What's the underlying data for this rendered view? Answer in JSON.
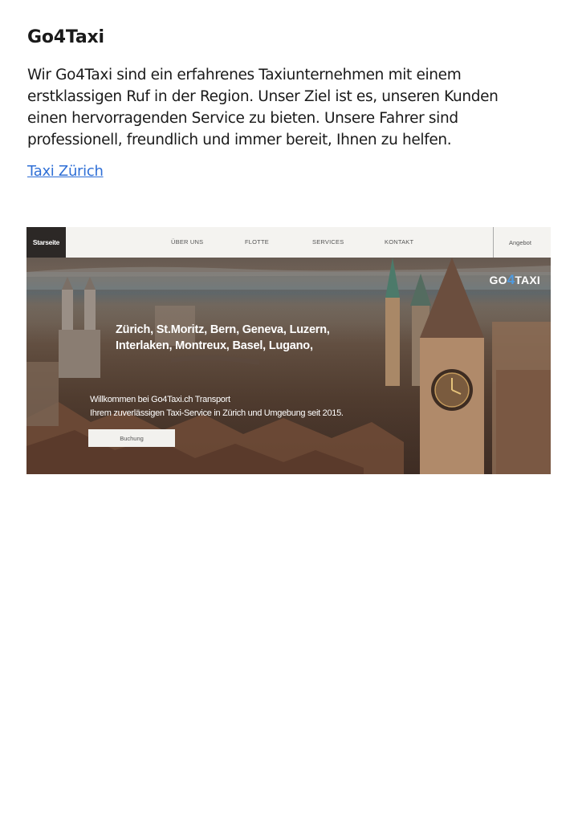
{
  "heading": "Go4Taxi",
  "description": "Wir Go4Taxi sind ein erfahrenes Taxiunternehmen mit einem erstklassigen Ruf in der Region. Unser Ziel ist es, unseren Kunden einen hervorragenden Service zu bieten. Unsere Fahrer sind professionell, freundlich und immer bereit, Ihnen zu helfen.",
  "link_text": "Taxi Zürich",
  "website": {
    "nav": {
      "home": "Starseite",
      "items": [
        "ÜBER UNS",
        "FLOTTE",
        "SERVICES",
        "KONTAKT"
      ],
      "offer": "Angebot"
    },
    "logo_prefix": "GO",
    "logo_digit": "4",
    "logo_suffix": "TAXI",
    "cities_line1": "Zürich, St.Moritz, Bern, Geneva, Luzern,",
    "cities_line2": "Interlaken, Montreux, Basel, Lugano,",
    "welcome_line1": "Willkommen bei Go4Taxi.ch Transport",
    "welcome_line2": "Ihrem zuverlässigen Taxi-Service in Zürich und Umgebung seit 2015.",
    "book_button": "Buchung"
  },
  "colors": {
    "link": "#2f6fd6",
    "logo_accent": "#4f9be0",
    "nav_home_bg": "#2c2826"
  }
}
